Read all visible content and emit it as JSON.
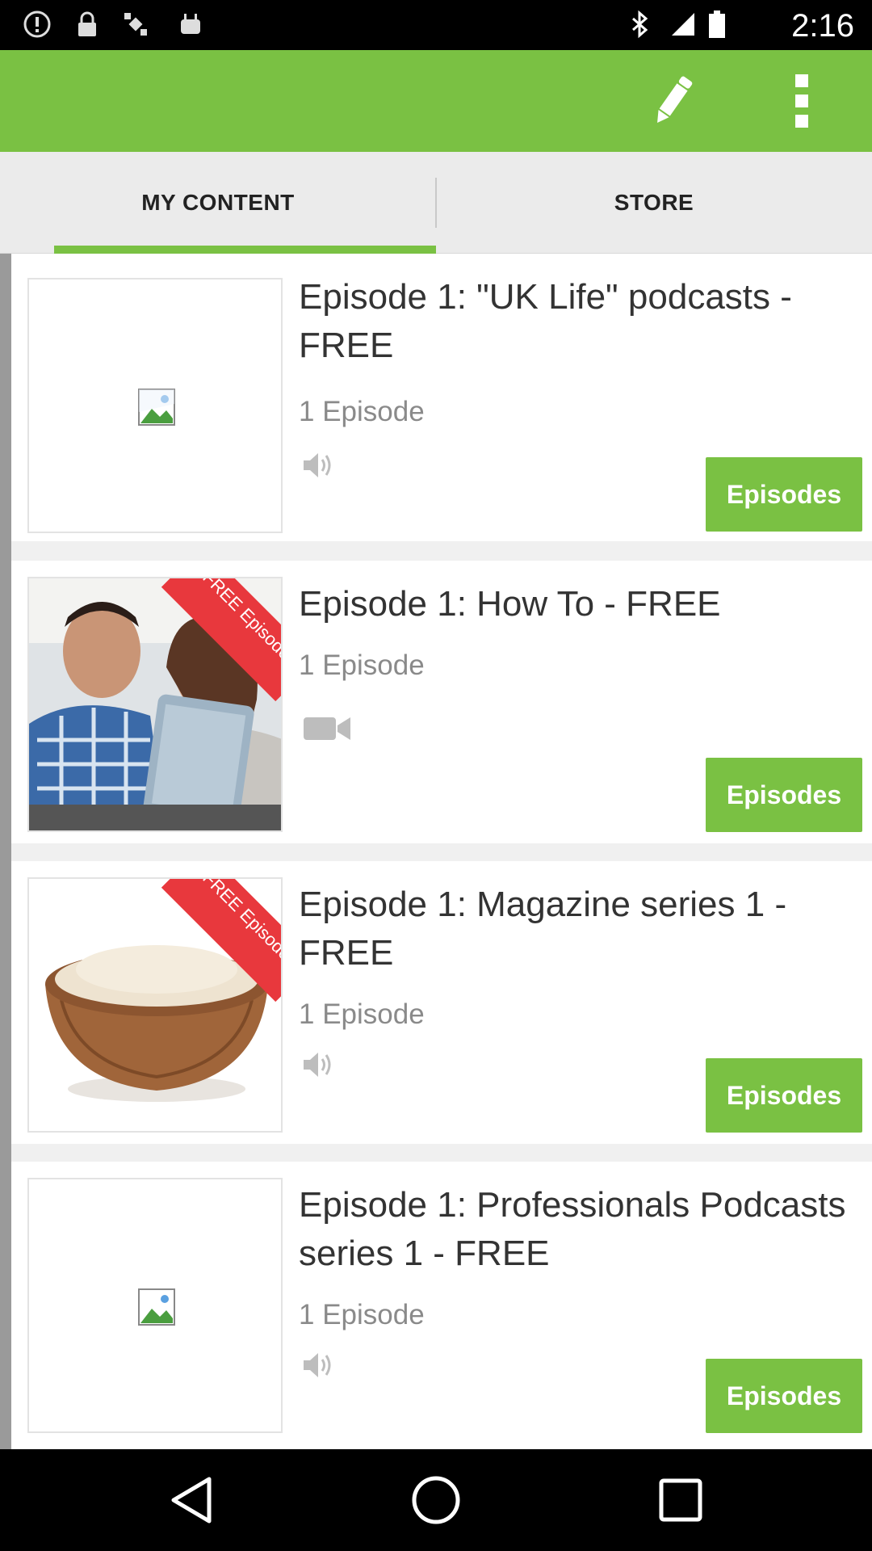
{
  "status_bar": {
    "time": "2:16",
    "left_icons": [
      "alert-icon",
      "lock-icon",
      "fake-gps-icon",
      "android-icon"
    ],
    "right_icons": [
      "bluetooth-icon",
      "signal-icon",
      "battery-icon"
    ]
  },
  "app_bar": {
    "background": "#7ac143",
    "actions": [
      "pencil-icon",
      "overflow-menu-icon"
    ]
  },
  "tabs": [
    {
      "label": "MY CONTENT",
      "selected": true
    },
    {
      "label": "STORE",
      "selected": false
    }
  ],
  "items": [
    {
      "title": "Episode 1: \"UK Life\" podcasts - FREE",
      "count": "1 Episode",
      "media": "audio-icon",
      "thumbnail": "broken-image-icon",
      "button": "Episodes"
    },
    {
      "title": "Episode 1: How To - FREE",
      "count": "1 Episode",
      "media": "video-icon",
      "thumbnail": "couple-with-tablet-photo",
      "ribbon": "FREE Episode",
      "button": "Episodes"
    },
    {
      "title": "Episode 1: Magazine series 1 - FREE",
      "count": "1 Episode",
      "media": "audio-icon",
      "thumbnail": "bowl-of-rice-photo",
      "ribbon": "FREE Episode",
      "button": "Episodes"
    },
    {
      "title": "Episode 1: Professionals Podcasts series 1 - FREE",
      "count": "1 Episode",
      "media": "audio-icon",
      "thumbnail": "broken-image-icon",
      "button": "Episodes"
    }
  ],
  "nav_bar": [
    "back-icon",
    "home-icon",
    "recents-icon"
  ],
  "colors": {
    "accent": "#7ac143",
    "ribbon": "#e8383d"
  }
}
